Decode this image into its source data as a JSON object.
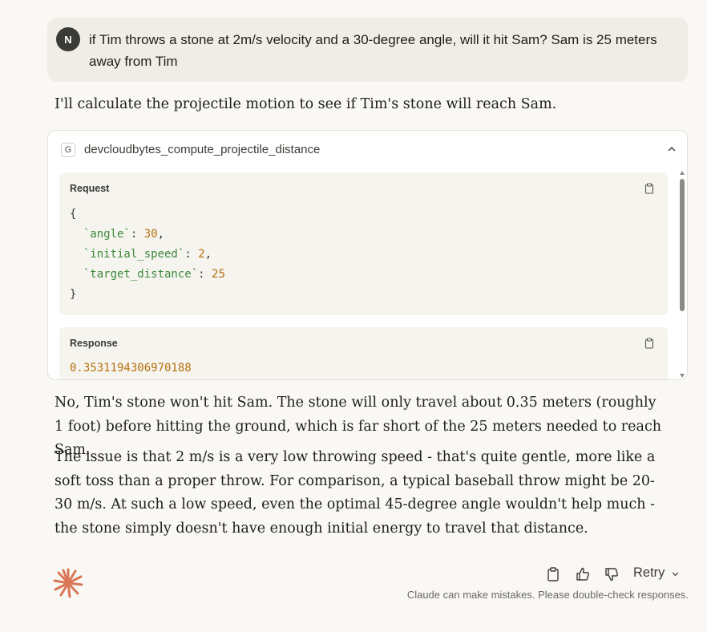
{
  "user_message": {
    "avatar_initial": "N",
    "text": "if Tim throws a stone at 2m/s velocity and a 30-degree angle, will it hit Sam? Sam is 25 meters away from Tim"
  },
  "assistant": {
    "intro": "I'll calculate the projectile motion to see if Tim's stone will reach Sam.",
    "tool_call": {
      "badge": "G",
      "name": "devcloudbytes_compute_projectile_distance",
      "request_label": "Request",
      "request_lines": {
        "open": "{",
        "line1_key": "`angle`",
        "line1_val": "30",
        "line2_key": "`initial_speed`",
        "line2_val": "2",
        "line3_key": "`target_distance`",
        "line3_val": "25",
        "close": "}"
      },
      "response_label": "Response",
      "response_value": "0.3531194306970188"
    },
    "paragraph1": "No, Tim's stone won't hit Sam. The stone will only travel about 0.35 meters (roughly 1 foot) before hitting the ground, which is far short of the 25 meters needed to reach Sam.",
    "paragraph2": "The issue is that 2 m/s is a very low throwing speed - that's quite gentle, more like a soft toss than a proper throw. For comparison, a typical baseball throw might be 20-30 m/s. At such a low speed, even the optimal 45-degree angle wouldn't help much - the stone simply doesn't have enough initial energy to travel that distance."
  },
  "footer": {
    "retry_label": "Retry",
    "disclaimer": "Claude can make mistakes. Please double-check responses."
  },
  "colors": {
    "background": "#f9f8f4",
    "user_bubble": "#efede6",
    "logo": "#d97757",
    "code_key": "#3d8a3b",
    "code_number": "#b6700c"
  }
}
